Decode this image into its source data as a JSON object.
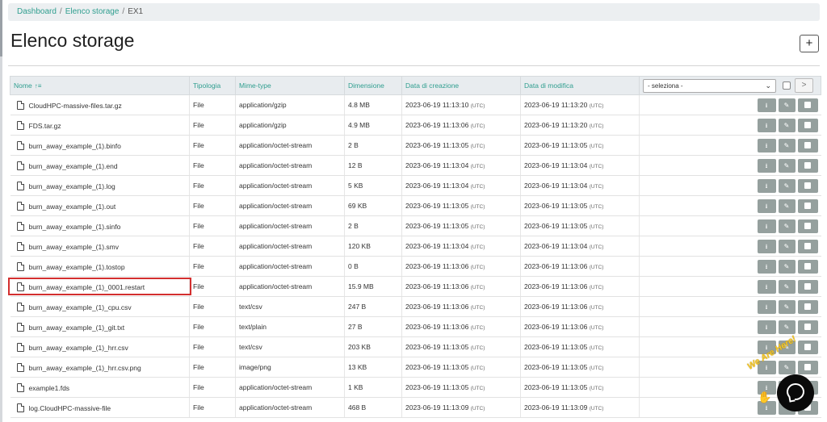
{
  "breadcrumb": {
    "items": [
      "Dashboard",
      "Elenco storage"
    ],
    "current": "EX1"
  },
  "page": {
    "title": "Elenco storage",
    "add_label": "+"
  },
  "table": {
    "headers": {
      "name": "Nome",
      "type": "Tipologia",
      "mime": "Mime-type",
      "size": "Dimensione",
      "created": "Data di creazione",
      "modified": "Data di modifica"
    },
    "bulk_select_value": "- seleziona -",
    "next_label": ">",
    "tz_label": "(UTC)",
    "rows": [
      {
        "name": "CloudHPC-massive-files.tar.gz",
        "type": "File",
        "mime": "application/gzip",
        "size": "4.8 MB",
        "created": "2023-06-19 11:13:10",
        "modified": "2023-06-19 11:13:20"
      },
      {
        "name": "FDS.tar.gz",
        "type": "File",
        "mime": "application/gzip",
        "size": "4.9 MB",
        "created": "2023-06-19 11:13:06",
        "modified": "2023-06-19 11:13:20"
      },
      {
        "name": "burn_away_example_(1).binfo",
        "type": "File",
        "mime": "application/octet-stream",
        "size": "2 B",
        "created": "2023-06-19 11:13:05",
        "modified": "2023-06-19 11:13:05"
      },
      {
        "name": "burn_away_example_(1).end",
        "type": "File",
        "mime": "application/octet-stream",
        "size": "12 B",
        "created": "2023-06-19 11:13:04",
        "modified": "2023-06-19 11:13:04"
      },
      {
        "name": "burn_away_example_(1).log",
        "type": "File",
        "mime": "application/octet-stream",
        "size": "5 KB",
        "created": "2023-06-19 11:13:04",
        "modified": "2023-06-19 11:13:04"
      },
      {
        "name": "burn_away_example_(1).out",
        "type": "File",
        "mime": "application/octet-stream",
        "size": "69 KB",
        "created": "2023-06-19 11:13:05",
        "modified": "2023-06-19 11:13:05"
      },
      {
        "name": "burn_away_example_(1).sinfo",
        "type": "File",
        "mime": "application/octet-stream",
        "size": "2 B",
        "created": "2023-06-19 11:13:05",
        "modified": "2023-06-19 11:13:05"
      },
      {
        "name": "burn_away_example_(1).smv",
        "type": "File",
        "mime": "application/octet-stream",
        "size": "120 KB",
        "created": "2023-06-19 11:13:04",
        "modified": "2023-06-19 11:13:04"
      },
      {
        "name": "burn_away_example_(1).tostop",
        "type": "File",
        "mime": "application/octet-stream",
        "size": "0 B",
        "created": "2023-06-19 11:13:06",
        "modified": "2023-06-19 11:13:06"
      },
      {
        "name": "burn_away_example_(1)_0001.restart",
        "type": "File",
        "mime": "application/octet-stream",
        "size": "15.9 MB",
        "created": "2023-06-19 11:13:06",
        "modified": "2023-06-19 11:13:06"
      },
      {
        "name": "burn_away_example_(1)_cpu.csv",
        "type": "File",
        "mime": "text/csv",
        "size": "247 B",
        "created": "2023-06-19 11:13:06",
        "modified": "2023-06-19 11:13:06"
      },
      {
        "name": "burn_away_example_(1)_git.txt",
        "type": "File",
        "mime": "text/plain",
        "size": "27 B",
        "created": "2023-06-19 11:13:06",
        "modified": "2023-06-19 11:13:06"
      },
      {
        "name": "burn_away_example_(1)_hrr.csv",
        "type": "File",
        "mime": "text/csv",
        "size": "203 KB",
        "created": "2023-06-19 11:13:05",
        "modified": "2023-06-19 11:13:05"
      },
      {
        "name": "burn_away_example_(1)_hrr.csv.png",
        "type": "File",
        "mime": "image/png",
        "size": "13 KB",
        "created": "2023-06-19 11:13:05",
        "modified": "2023-06-19 11:13:05"
      },
      {
        "name": "example1.fds",
        "type": "File",
        "mime": "application/octet-stream",
        "size": "1 KB",
        "created": "2023-06-19 11:13:05",
        "modified": "2023-06-19 11:13:05"
      },
      {
        "name": "log.CloudHPC-massive-file",
        "type": "File",
        "mime": "application/octet-stream",
        "size": "468 B",
        "created": "2023-06-19 11:13:09",
        "modified": "2023-06-19 11:13:09"
      }
    ]
  },
  "chat": {
    "teaser": "We Are Here!"
  },
  "icons": {
    "file": "file-icon",
    "download": "download-icon",
    "edit": "edit-icon",
    "select": "checkbox-icon",
    "chat": "chat-icon",
    "sort": "sort-icon"
  },
  "colors": {
    "accent": "#2f9e8f",
    "action_button": "#95a09e",
    "highlight": "#d32f2f"
  }
}
